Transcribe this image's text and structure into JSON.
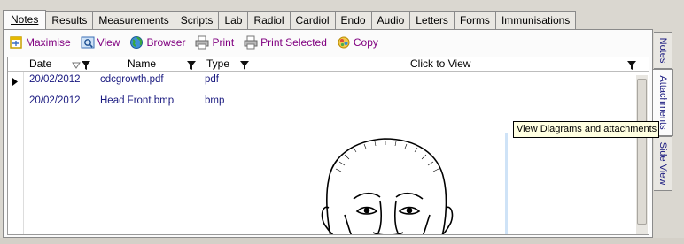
{
  "tabs": [
    {
      "label": "Notes",
      "active": true
    },
    {
      "label": "Results"
    },
    {
      "label": "Measurements"
    },
    {
      "label": "Scripts"
    },
    {
      "label": "Lab"
    },
    {
      "label": "Radiol"
    },
    {
      "label": "Cardiol"
    },
    {
      "label": "Endo"
    },
    {
      "label": "Audio"
    },
    {
      "label": "Letters"
    },
    {
      "label": "Forms"
    },
    {
      "label": "Immunisations"
    }
  ],
  "toolbar": {
    "maximise": "Maximise",
    "view": "View",
    "browser": "Browser",
    "print": "Print",
    "print_selected": "Print Selected",
    "copy": "Copy"
  },
  "grid": {
    "columns": {
      "date": "Date",
      "name": "Name",
      "type": "Type",
      "click_to_view": "Click to View"
    },
    "rows": [
      {
        "date": "20/02/2012",
        "name": "cdcgrowth.pdf",
        "type": "pdf"
      },
      {
        "date": "20/02/2012",
        "name": "Head Front.bmp",
        "type": "bmp"
      }
    ]
  },
  "side_tabs": [
    {
      "label": "Notes"
    },
    {
      "label": "Attachments",
      "active": true
    },
    {
      "label": "Side View"
    }
  ],
  "tooltip": "View Diagrams and attachments",
  "colors": {
    "toolbar_text": "#800080",
    "row_text": "#1a1a80",
    "tooltip_bg": "#ffffe1"
  }
}
